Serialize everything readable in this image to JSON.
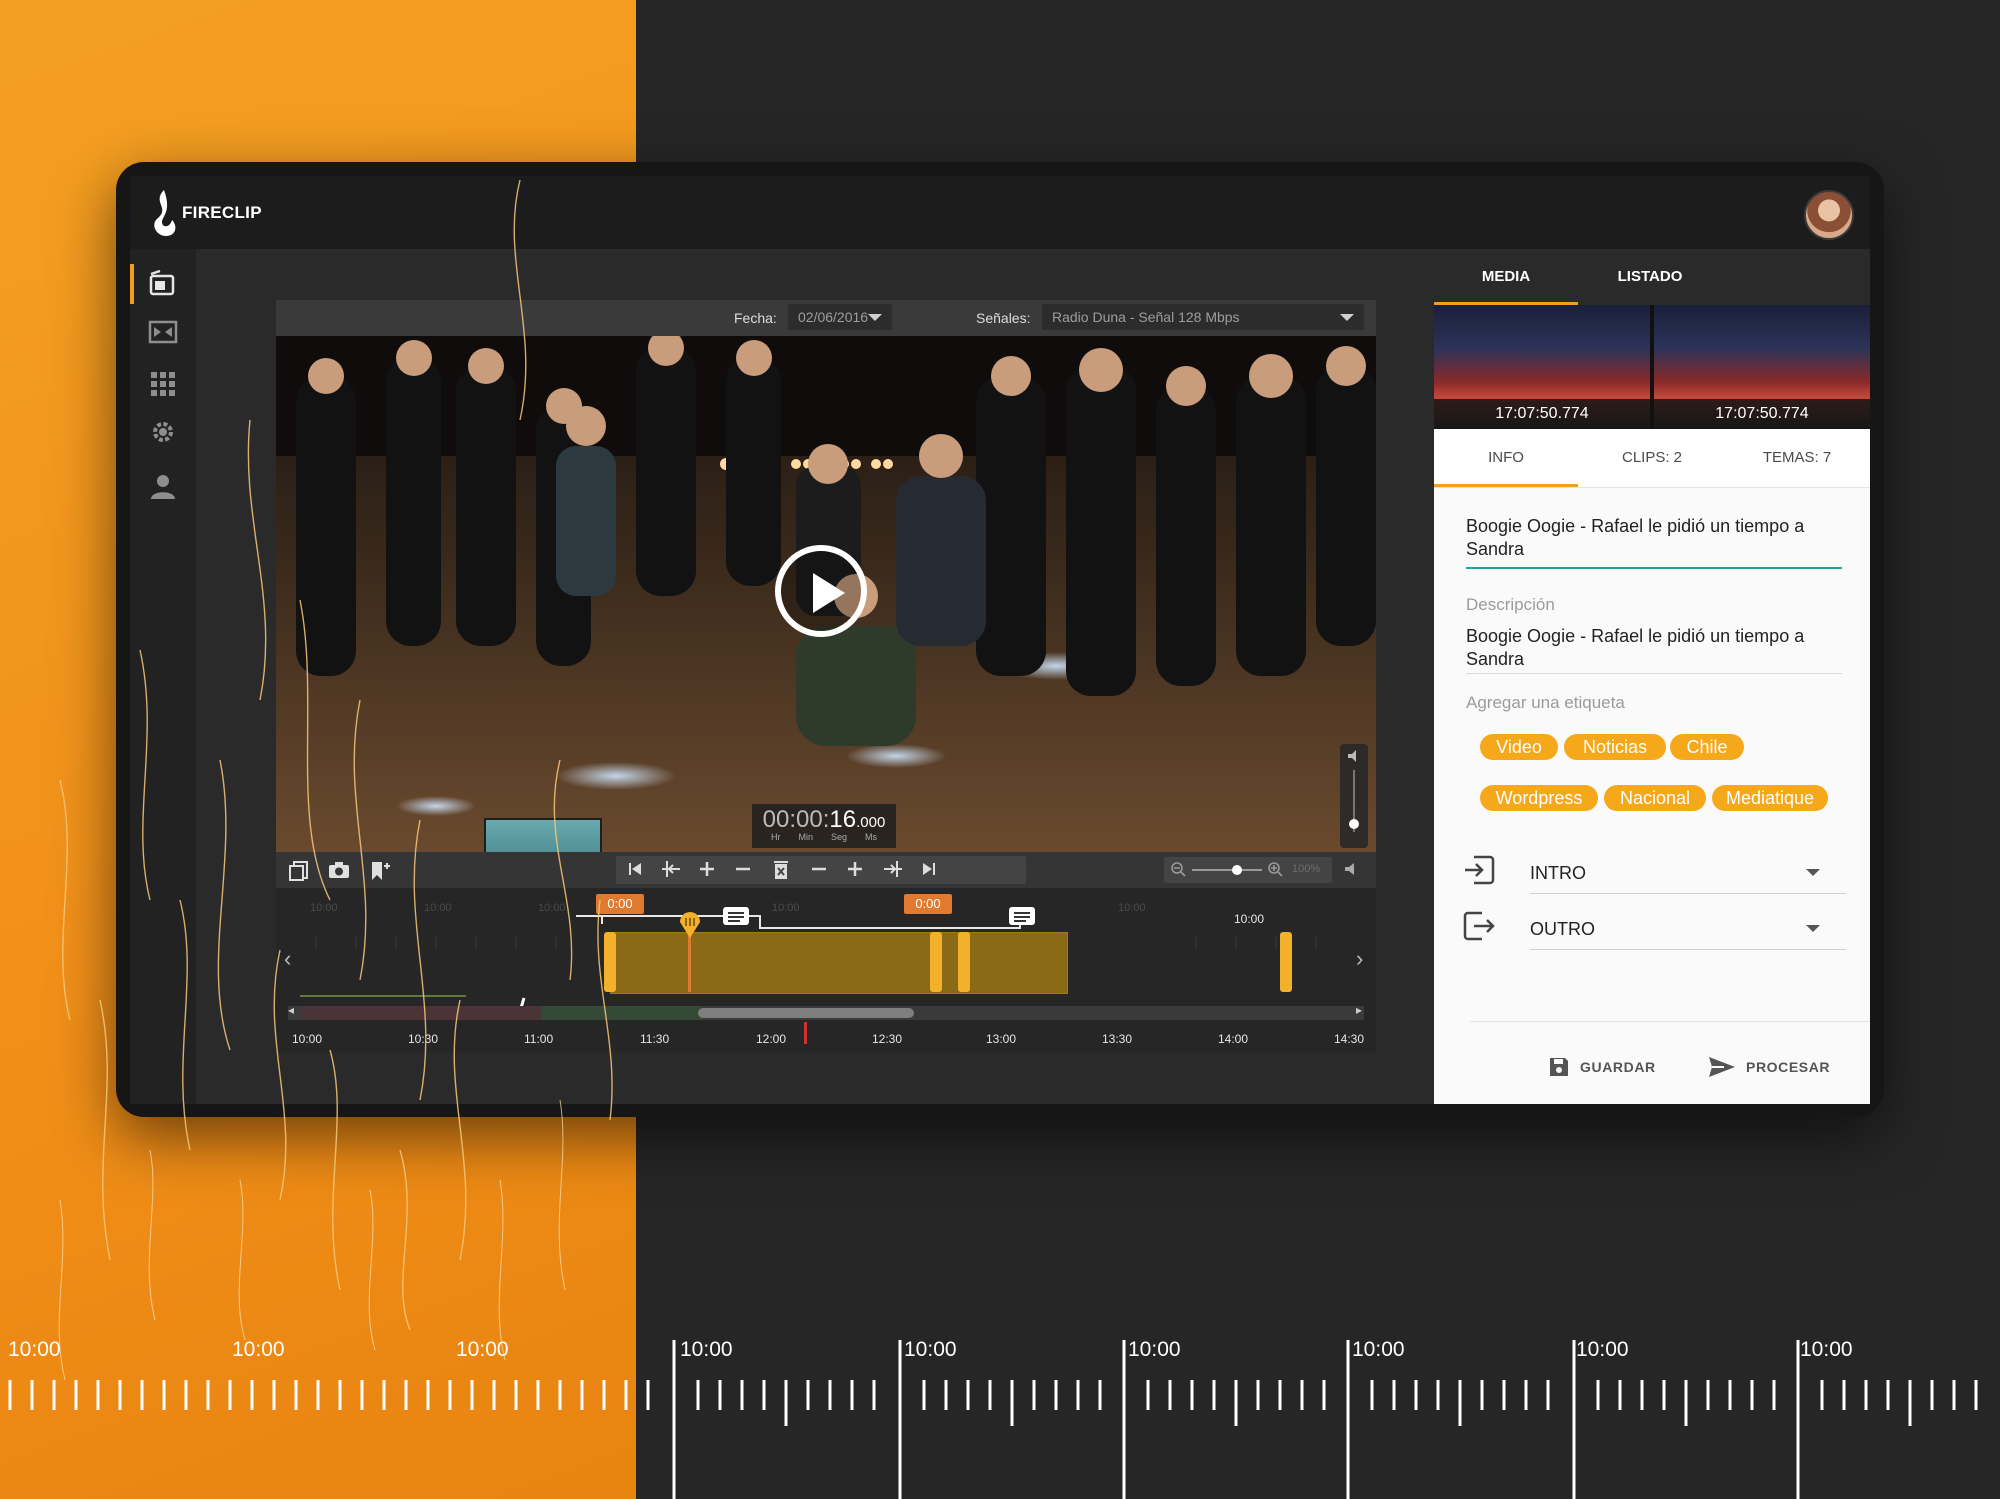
{
  "app": {
    "name": "FIRECLIP"
  },
  "player": {
    "date_label": "Fecha:",
    "date_value": "02/06/2016",
    "signals_label": "Señales:",
    "signals_value": "Radio Duna - Señal 128 Mbps",
    "timecode": {
      "hms": "00:00:",
      "seconds": "16",
      "ms": ".000",
      "units": [
        "Hr",
        "Min",
        "Seg",
        "Ms"
      ]
    },
    "zoom_value": "100%"
  },
  "timeline": {
    "markers": [
      "0:00",
      "0:00"
    ],
    "top_label": "10:00",
    "bottom_labels": [
      "10:00",
      "10:30",
      "11:00",
      "11:30",
      "12:00",
      "12:30",
      "13:00",
      "13:30",
      "14:00",
      "14:30"
    ]
  },
  "panel": {
    "tabs": [
      "MEDIA",
      "LISTADO"
    ],
    "thumbnails": [
      {
        "time": "17:07:50.774"
      },
      {
        "time": "17:07:50.774"
      }
    ],
    "info_tabs": [
      "INFO",
      "CLIPS: 2",
      "TEMAS: 7"
    ],
    "title": "Boogie Oogie - Rafael le pidió un tiempo a Sandra",
    "description_label": "Descripción",
    "description": "Boogie Oogie - Rafael le pidió un tiempo a Sandra",
    "tag_label": "Agregar una etiqueta",
    "tags": [
      "Video",
      "Noticias",
      "Chile",
      "Wordpress",
      "Nacional",
      "Mediatique"
    ],
    "intro_label": "INTRO",
    "outro_label": "OUTRO",
    "save_label": "GUARDAR",
    "process_label": "PROCESAR"
  },
  "ruler": {
    "labels": [
      "10:00",
      "10:00",
      "10:00",
      "10:00",
      "10:00",
      "10:00",
      "10:00",
      "10:00",
      "10:00"
    ]
  },
  "colors": {
    "accent": "#f49d1d",
    "teal": "#1aa39a",
    "clip": "#8a6a16",
    "orange_bg": "#f2911a"
  }
}
